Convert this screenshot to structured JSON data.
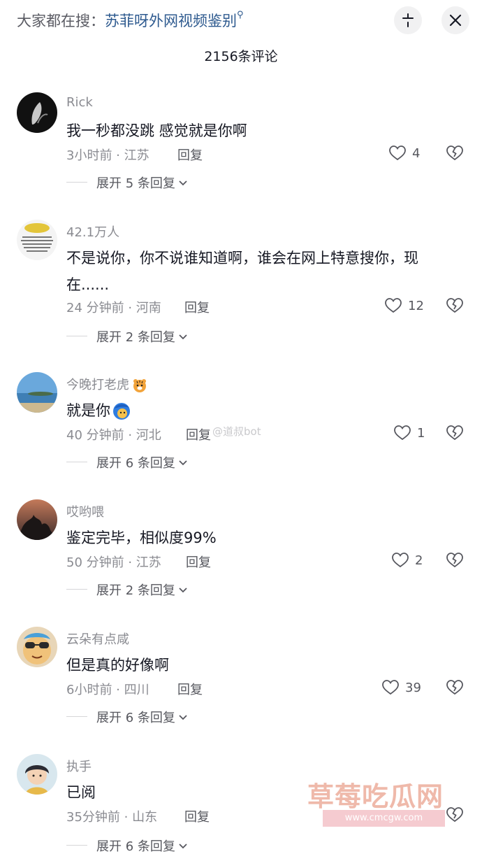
{
  "header": {
    "search_prefix": "大家都在搜：",
    "search_keyword": "苏菲呀外网视频鉴别",
    "search_icon": "search-icon",
    "collapse_icon": "collapse-icon",
    "close_icon": "close-icon"
  },
  "comment_count": "2156条评论",
  "comments": [
    {
      "username": "Rick",
      "text": "我一秒都没跳 感觉就是你啊",
      "meta": "3小时前 · 江苏",
      "reply": "回复",
      "likes": "4",
      "expand": "展开 5 条回复"
    },
    {
      "username": "42.1万人",
      "text": "不是说你，你不说谁知道啊，谁会在网上特意搜你，现在......",
      "meta": "24 分钟前 · 河南",
      "reply": "回复",
      "likes": "12",
      "expand": "展开 2 条回复"
    },
    {
      "username": "今晚打老虎",
      "text": "就是你",
      "meta": "40 分钟前 · 河北",
      "reply": "回复",
      "likes": "1",
      "expand": "展开 6 条回复"
    },
    {
      "username": "哎哟喂",
      "text": "鉴定完毕，相似度99%",
      "meta": "50 分钟前 · 江苏",
      "reply": "回复",
      "likes": "2",
      "expand": "展开 2 条回复"
    },
    {
      "username": "云朵有点咸",
      "text": "但是真的好像啊",
      "meta": "6小时前 · 四川",
      "reply": "回复",
      "likes": "39",
      "expand": "展开 6 条回复"
    },
    {
      "username": "执手",
      "text": "已阅",
      "meta": "35分钟前 · 山东",
      "reply": "回复",
      "likes": "",
      "expand": "展开 6 条回复"
    }
  ],
  "watermarks": {
    "weibo": "@道叔bot",
    "site": "草莓吃瓜网",
    "url": "www.cmcgw.com"
  }
}
